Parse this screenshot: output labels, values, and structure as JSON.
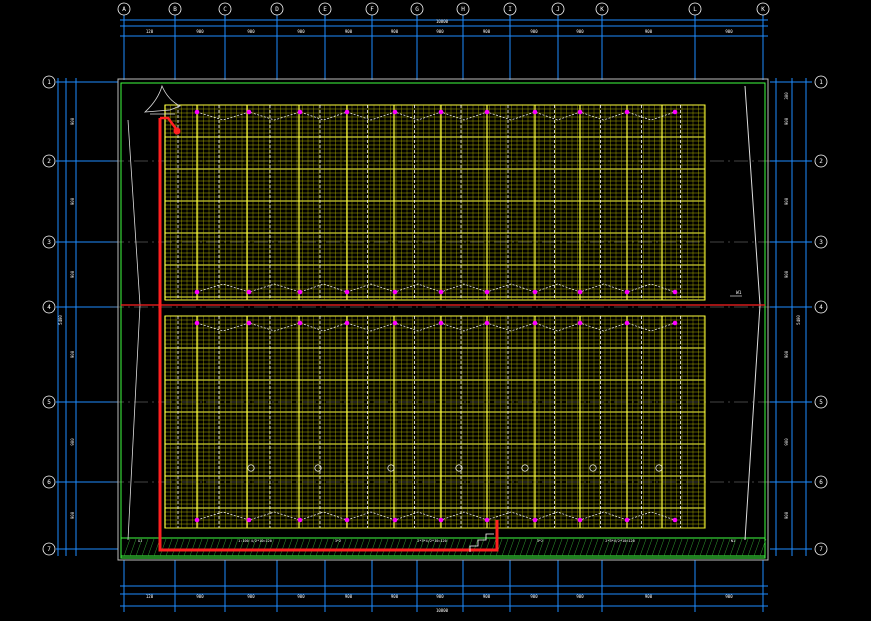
{
  "colors": {
    "background": "#000000",
    "grid_line": "#ffffff",
    "dim_line": "#1e8cff",
    "panel": "#ffff40",
    "panel_dim": "#c8c800",
    "bus": "#ff2020",
    "outline": "#40ff40",
    "node": "#ff00ff",
    "hatch": "#30a030"
  },
  "columns": [
    "A",
    "B",
    "C",
    "D",
    "E",
    "F",
    "G",
    "H",
    "I",
    "J",
    "K",
    "L",
    "K"
  ],
  "rows": [
    "1",
    "2",
    "3",
    "4",
    "5",
    "6",
    "7"
  ],
  "top_dims": [
    "120",
    "900",
    "900",
    "900",
    "900",
    "900",
    "900",
    "900",
    "900",
    "900",
    "900",
    "900"
  ],
  "bottom_dims": [
    "120",
    "900",
    "900",
    "900",
    "900",
    "900",
    "900",
    "900",
    "900",
    "900",
    "900",
    "900"
  ],
  "total_dim_top": "10800",
  "total_dim_bottom": "10800",
  "left_dims": [
    "900",
    "900",
    "900",
    "900",
    "900",
    "900"
  ],
  "left_total": "5400",
  "right_dims": [
    "300",
    "900",
    "900",
    "900",
    "900",
    "900",
    "900"
  ],
  "right_total": "5400",
  "bottom_strip_labels": [
    "G1",
    "1:100 4/2*10=120",
    "3*2",
    "2*3*4/2*10=120",
    "3*2",
    "2*3*4/2*10=120",
    "N1"
  ],
  "feeder_label": "W1",
  "icons": [
    "inverter-icon"
  ]
}
